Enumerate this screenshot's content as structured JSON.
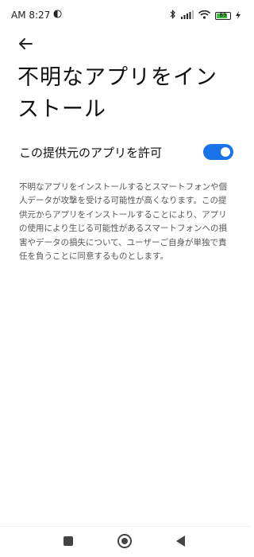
{
  "status": {
    "time": "AM 8:27",
    "battery_level": "89",
    "battery_fill_fraction": 0.89
  },
  "header": {
    "back_icon": "arrow-left-icon",
    "title": "不明なアプリをインストール"
  },
  "setting": {
    "label": "この提供元のアプリを許可",
    "enabled": true
  },
  "description": "不明なアプリをインストールするとスマートフォンや個人データが攻撃を受ける可能性が高くなります。この提供元からアプリをインストールすることにより、アプリの使用により生じる可能性があるスマートフォンへの損害やデータの損失について、ユーザーご自身が単独で責任を負うことに同意するものとします。",
  "colors": {
    "accent": "#1a73e8",
    "battery": "#3bbf3b"
  },
  "nav": {
    "recent_icon": "square-icon",
    "home_icon": "home-circle-icon",
    "back_icon": "back-triangle-icon"
  }
}
